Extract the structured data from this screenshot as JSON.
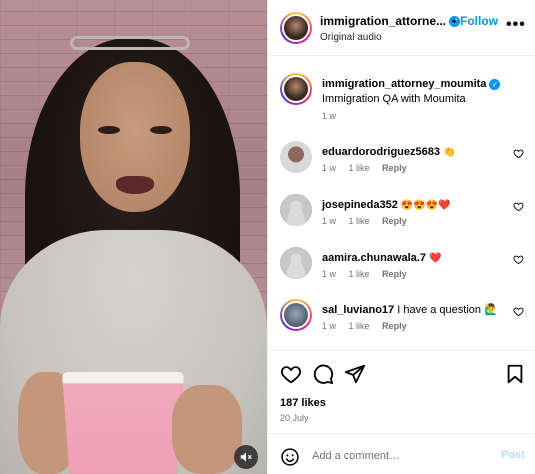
{
  "header": {
    "username": "immigration_attorne...",
    "follow_label": "Follow",
    "audio": "Original audio",
    "dot": "•",
    "more": "•••"
  },
  "caption": {
    "username": "immigration_attorney_moumita",
    "text": "Immigration QA with Moumita",
    "time": "1 w"
  },
  "comments": [
    {
      "username": "eduardorodriguez5683",
      "text": "👏",
      "time": "1 w",
      "likes": "1 like",
      "reply": "Reply"
    },
    {
      "username": "josepineda352",
      "text": "😍😍😍❤️",
      "time": "1 w",
      "likes": "1 like",
      "reply": "Reply"
    },
    {
      "username": "aamira.chunawala.7",
      "text": "❤️",
      "time": "1 w",
      "likes": "1 like",
      "reply": "Reply"
    },
    {
      "username": "sal_luviano17",
      "text": "I have a question 🙋‍♂️",
      "time": "1 w",
      "likes": "1 like",
      "reply": "Reply"
    }
  ],
  "stats": {
    "likes": "187 likes",
    "date": "20 July"
  },
  "composer": {
    "placeholder": "Add a comment…",
    "post_label": "Post"
  },
  "colors": {
    "accent": "#0095f6",
    "post_disabled": "#b2dffc",
    "muted_text": "#737373"
  }
}
